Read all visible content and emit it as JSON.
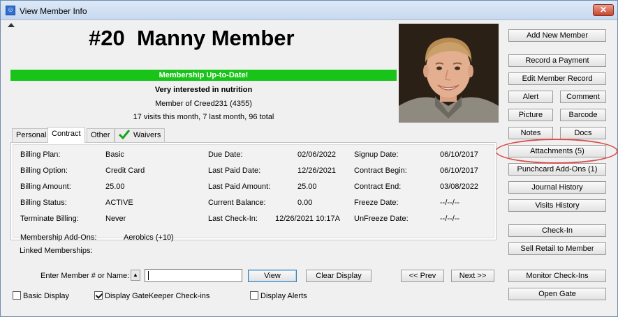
{
  "window": {
    "title": "View Member Info",
    "close_glyph": "✕",
    "app_icon": "person-icon"
  },
  "member": {
    "heading": "#20  Manny Member",
    "status": "Membership Up-to-Date!",
    "note": "Very interested in nutrition",
    "member_of": "Member of Creed231 (4355)",
    "visits": "17 visits this month, 7 last month, 96 total"
  },
  "colors": {
    "status_green": "#19c419",
    "annotation_red": "#d9504f",
    "focus_blue": "#3c7fb1"
  },
  "tabs": [
    {
      "label": "Personal",
      "active": false
    },
    {
      "label": "Contract",
      "active": true
    },
    {
      "label": "Other",
      "active": false
    },
    {
      "label": "Waivers",
      "active": false,
      "icon": "checkmark-icon"
    }
  ],
  "contract": {
    "col1": [
      {
        "label": "Billing Plan:",
        "value": "Basic"
      },
      {
        "label": "Billing Option:",
        "value": "Credit Card"
      },
      {
        "label": "Billing Amount:",
        "value": "25.00"
      },
      {
        "label": "Billing Status:",
        "value": "ACTIVE"
      },
      {
        "label": "Terminate Billing:",
        "value": "Never"
      }
    ],
    "col2": [
      {
        "label": "Due Date:",
        "value": "02/06/2022"
      },
      {
        "label": "Last Paid Date:",
        "value": "12/26/2021"
      },
      {
        "label": "Last Paid Amount:",
        "value": "25.00"
      },
      {
        "label": "Current Balance:",
        "value": "0.00"
      },
      {
        "label": "Last Check-In:",
        "value": "12/26/2021 10:17A"
      }
    ],
    "col3": [
      {
        "label": "Signup Date:",
        "value": "06/10/2017"
      },
      {
        "label": "Contract Begin:",
        "value": "06/10/2017"
      },
      {
        "label": "Contract End:",
        "value": "03/08/2022"
      },
      {
        "label": "Freeze Date:",
        "value": "--/--/--"
      },
      {
        "label": "UnFreeze Date:",
        "value": "--/--/--"
      }
    ],
    "addons_label": "Membership Add-Ons:",
    "addons_value": "Aerobics (+10)",
    "linked_label": "Linked Memberships:"
  },
  "right_buttons": {
    "add_new_member": "Add New Member",
    "record_payment": "Record a Payment",
    "edit_member_record": "Edit Member Record",
    "alert": "Alert",
    "comment": "Comment",
    "picture": "Picture",
    "barcode": "Barcode",
    "notes": "Notes",
    "docs": "Docs",
    "attachments": "Attachments (5)",
    "punchcard_addons": "Punchcard Add-Ons (1)",
    "journal_history": "Journal History",
    "visits_history": "Visits History",
    "check_in": "Check-In",
    "sell_retail": "Sell Retail to Member",
    "monitor_checkins": "Monitor Check-Ins",
    "open_gate": "Open Gate"
  },
  "bottom": {
    "enter_label": "Enter Member # or Name:",
    "updown_glyph": "▲",
    "input_value": "",
    "view": "View",
    "clear_display": "Clear Display",
    "prev": "<< Prev",
    "next": "Next >>"
  },
  "checkboxes": [
    {
      "label": "Basic Display",
      "checked": false
    },
    {
      "label": "Display GateKeeper Check-ins",
      "checked": true
    },
    {
      "label": "Display Alerts",
      "checked": false
    }
  ]
}
